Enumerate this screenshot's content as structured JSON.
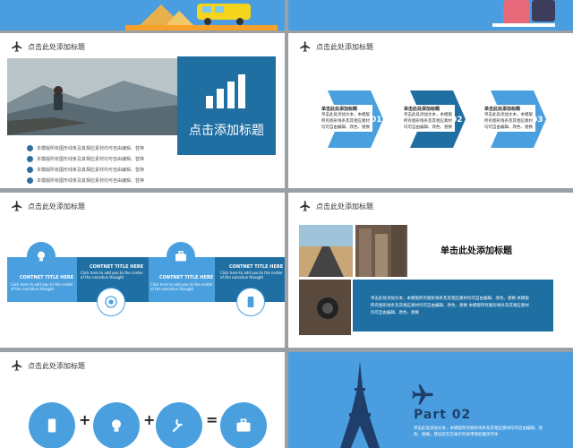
{
  "slide_header": "点击此处添加标题",
  "slide1": {
    "big_title": "点击添加标题",
    "bullets": [
      "本模版所有图形线条及其相应素材均可自由编辑、替换",
      "本模版所有图形线条及其相应素材均可自由编辑、替换",
      "本模版所有图形线条及其相应素材均可自由编辑、替换",
      "本模版所有图形线条及其相应素材均可自由编辑、替换"
    ]
  },
  "slide2": {
    "steps": [
      {
        "title": "单击此处添加标题",
        "text": "单击此处添加文本，本模版所有图形线条及其相应素材均可自由编辑、改色、替换",
        "num": "01"
      },
      {
        "title": "单击此处添加标题",
        "text": "单击此处添加文本，本模版所有图形线条及其相应素材均可自由编辑、改色、替换",
        "num": "02"
      },
      {
        "title": "单击此处添加标题",
        "text": "单击此处添加文本，本模版所有图形线条及其相应素材均可自由编辑、改色、替换",
        "num": "03"
      }
    ]
  },
  "slide3": {
    "items": [
      {
        "title": "CONTNET   TITLE   HERE",
        "text": "Click here to add you to the center of the narrative thought"
      },
      {
        "title": "CONTNET   TITLE   HERE",
        "text": "Click here to add you to the center of the narrative thought"
      },
      {
        "title": "CONTNET   TITLE   HERE",
        "text": "Click here to add you to the center of the narrative thought"
      },
      {
        "title": "CONTNET   TITLE   HERE",
        "text": "Click here to add you to the center of the narrative thought"
      }
    ]
  },
  "slide4": {
    "title": "单击此处添加标题",
    "body": "单击此处添加文本，本模版所有图形线条及其相应素材均可自由编辑、改色、替换 本模版所有图形线条及其相应素材均可自由编辑、改色、替换 本模版所有图形线条及其相应素材均可自由编辑、改色、替换"
  },
  "slide5": {
    "operators": [
      "+",
      "+",
      "="
    ]
  },
  "slide6": {
    "part_label": "Part 02",
    "text": "单击此处添加文本，本模版所有图形线条及其相应素材均可自由编辑、改色、替换。建议您在在展示时采用微软雅黑字体"
  },
  "colors": {
    "accent": "#3a95dc",
    "dark_blue": "#1f6fa3",
    "light_blue": "#4aa0df"
  },
  "icons": [
    "plane-icon",
    "bar-chart-icon",
    "bulb-icon",
    "briefcase-icon",
    "target-icon",
    "phone-icon",
    "tools-icon",
    "eiffel-tower"
  ]
}
